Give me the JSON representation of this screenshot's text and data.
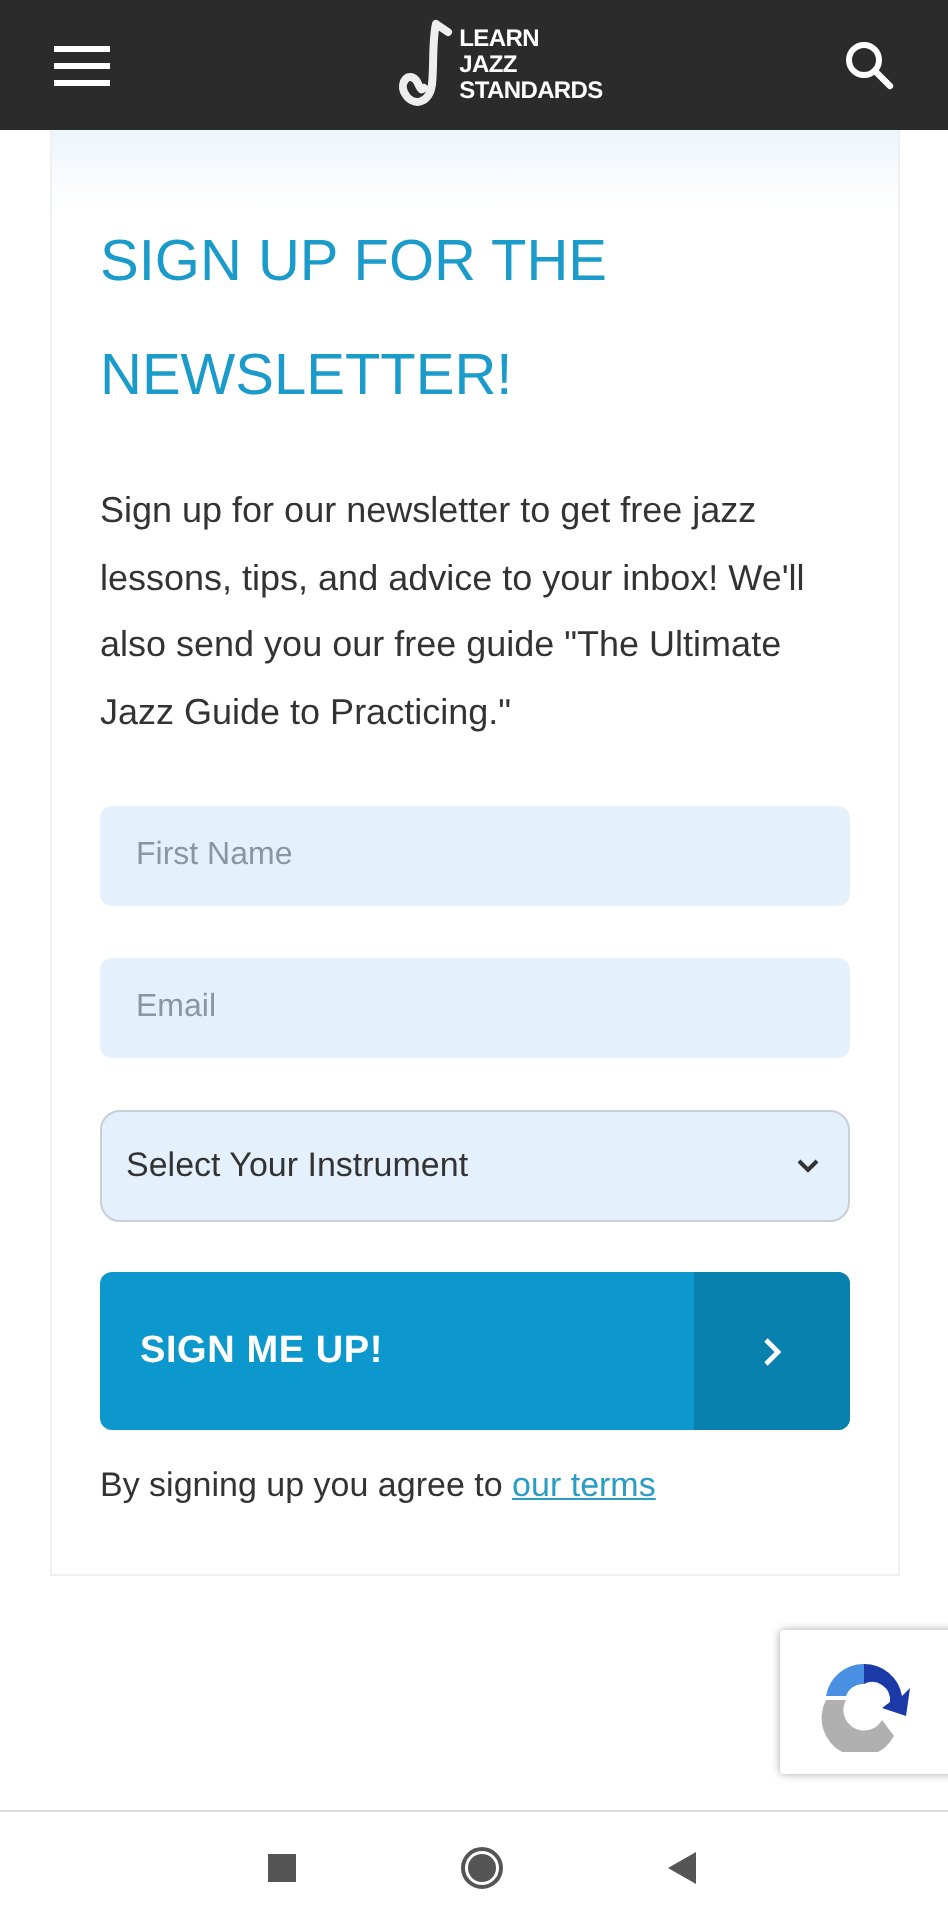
{
  "header": {
    "logo_lines": [
      "LEARN",
      "JAZZ",
      "STANDARDS"
    ]
  },
  "signup": {
    "title": "SIGN UP FOR THE NEWSLETTER!",
    "description": "Sign up for our newsletter to get free jazz lessons, tips, and advice to your inbox! We'll also send you our free guide \"The Ultimate Jazz Guide to Practicing.\"",
    "fields": [
      {
        "kind": "input",
        "placeholder": "First Name"
      },
      {
        "kind": "input",
        "placeholder": "Email"
      },
      {
        "kind": "select",
        "value": "Select Your Instrument"
      }
    ],
    "submit": "SIGN ME UP!",
    "terms_text": "By signing up you agree to",
    "terms_link": "our terms"
  }
}
